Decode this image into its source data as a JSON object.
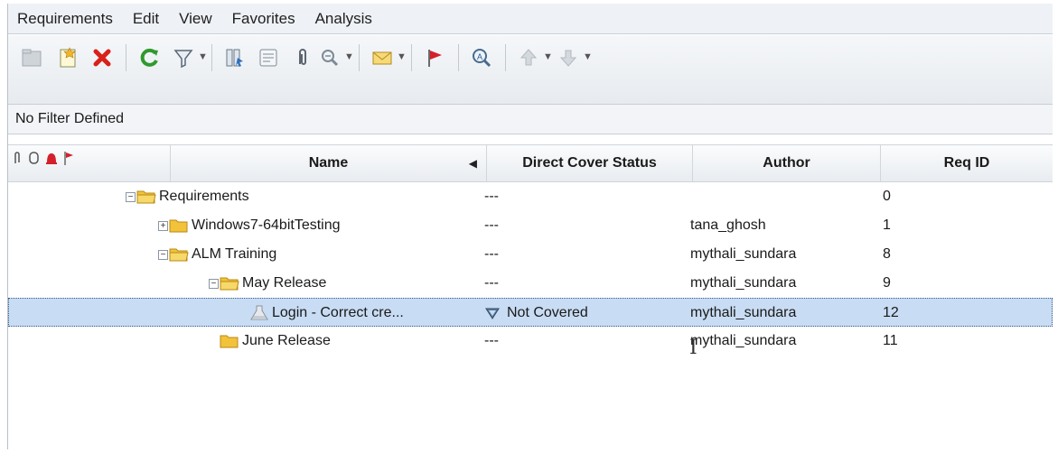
{
  "menu": [
    "Requirements",
    "Edit",
    "View",
    "Favorites",
    "Analysis"
  ],
  "toolbar": {
    "buttons": [
      "new-folder",
      "new-requirement",
      "delete",
      "refresh",
      "filter",
      "select-columns",
      "details",
      "attachments",
      "zoom",
      "send-email",
      "flag",
      "search",
      "move-up",
      "move-down"
    ]
  },
  "filter_text": "No Filter Defined",
  "columns": {
    "name": "Name",
    "direct_cover_status": "Direct Cover Status",
    "author": "Author",
    "req_id": "Req ID"
  },
  "rows": [
    {
      "name": "Requirements",
      "status": "---",
      "author": "",
      "req_id": "0",
      "expander": "−",
      "type": "folder",
      "level": 0,
      "selected": false
    },
    {
      "name": "Windows7-64bitTesting",
      "status": "---",
      "author": "tana_ghosh",
      "req_id": "1",
      "expander": "+",
      "type": "folder",
      "level": 1,
      "selected": false
    },
    {
      "name": "ALM Training",
      "status": "---",
      "author": "mythali_sundara",
      "req_id": "8",
      "expander": "−",
      "type": "folder",
      "level": 1,
      "selected": false
    },
    {
      "name": "May Release",
      "status": "---",
      "author": "mythali_sundara",
      "req_id": "9",
      "expander": "−",
      "type": "folder",
      "level": 2,
      "selected": false
    },
    {
      "name": "Login - Correct cre...",
      "status": "Not Covered",
      "author": "mythali_sundara",
      "req_id": "12",
      "expander": "",
      "type": "requirement",
      "level": 3,
      "selected": true
    },
    {
      "name": "June Release",
      "status": "---",
      "author": "mythali_sundara",
      "req_id": "11",
      "expander": "",
      "type": "folder",
      "level": 2,
      "selected": false
    }
  ],
  "colors": {
    "selection": "#c8dcf3",
    "folder": "#f2c23a",
    "delete": "#d9201a",
    "refresh": "#2f9a2f",
    "flag": "#d3202a"
  }
}
